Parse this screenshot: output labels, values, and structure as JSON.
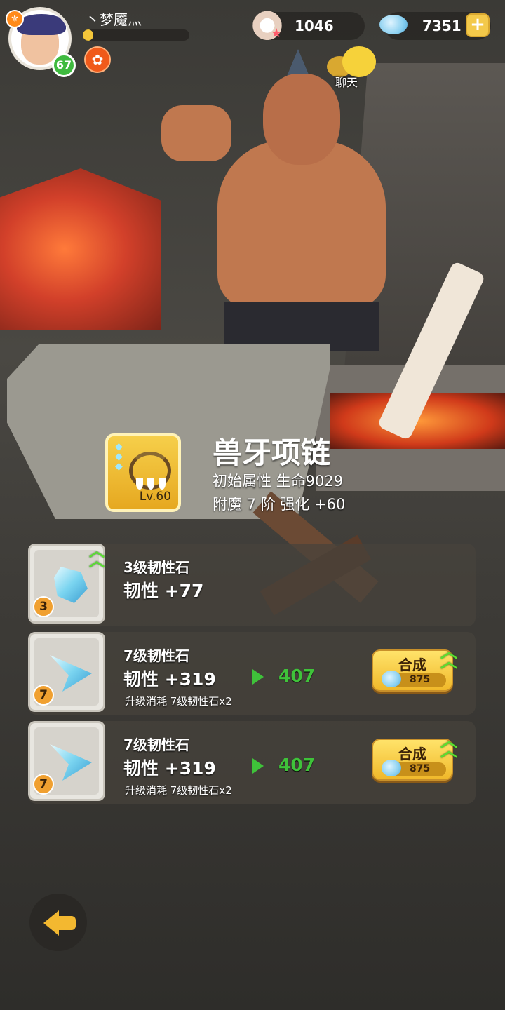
{
  "player": {
    "name": "丶梦魇灬",
    "level": "67",
    "exp_fraction": 0.1
  },
  "currencies": {
    "pearl": "1046",
    "gem": "7351",
    "add_symbol": "+"
  },
  "chat": {
    "label": "聊天"
  },
  "item": {
    "name": "兽牙项链",
    "level": "Lv.60",
    "base_attr": "初始属性 生命9029",
    "enchant": "附魔 7 阶  强化 +60"
  },
  "stones": [
    {
      "badge": "3",
      "name": "3级韧性石",
      "stat": "韧性  +77"
    },
    {
      "badge": "7",
      "name": "7级韧性石",
      "stat": "韧性  +319",
      "next": "407",
      "cost": "升级消耗 7级韧性石x2",
      "button": {
        "label": "合成",
        "cost": "875"
      }
    },
    {
      "badge": "7",
      "name": "7级韧性石",
      "stat": "韧性  +319",
      "next": "407",
      "cost": "升级消耗 7级韧性石x2",
      "button": {
        "label": "合成",
        "cost": "875"
      }
    }
  ],
  "icons": {
    "back": "back-arrow-icon",
    "upgrade": "upgrade-chevron-icon"
  }
}
